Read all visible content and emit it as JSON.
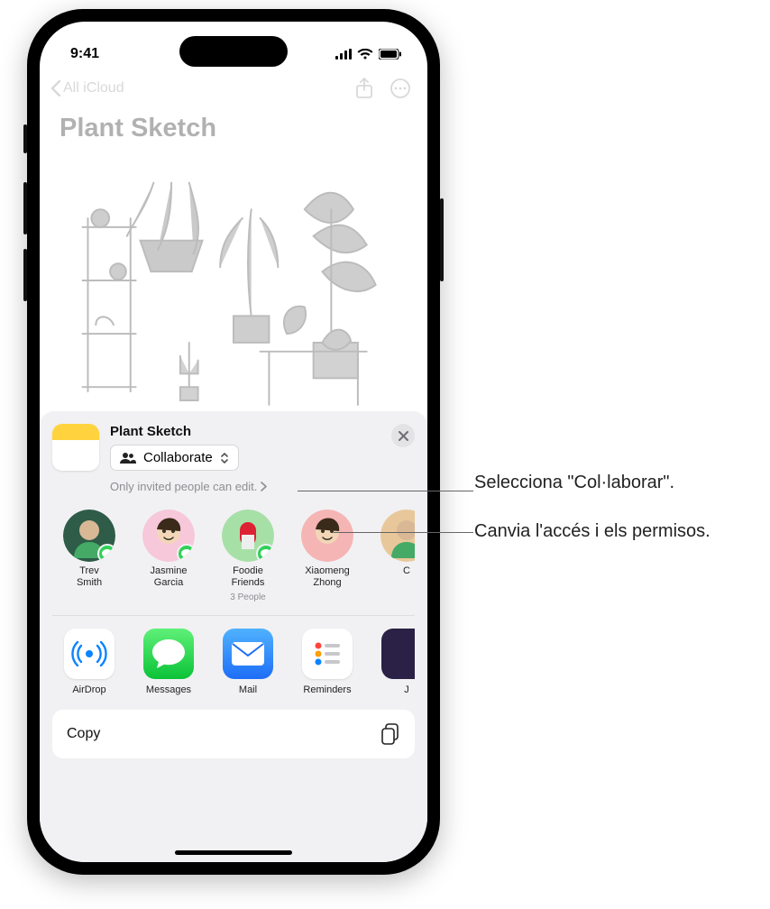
{
  "status": {
    "time": "9:41"
  },
  "nav": {
    "back_label": "All iCloud"
  },
  "note": {
    "title": "Plant Sketch"
  },
  "sheet": {
    "title": "Plant Sketch",
    "collab_label": "Collaborate",
    "permissions_text": "Only invited people can edit."
  },
  "contacts": [
    {
      "name": "Trev Smith",
      "sub": "",
      "avatar_color": "#2e5c48",
      "type": "photo"
    },
    {
      "name": "Jasmine Garcia",
      "sub": "",
      "avatar_color": "#f7c7da",
      "type": "memoji"
    },
    {
      "name": "Foodie Friends",
      "sub": "3 People",
      "avatar_color": "#a7e0a7",
      "type": "group"
    },
    {
      "name": "Xiaomeng Zhong",
      "sub": "",
      "avatar_color": "#f5b5b5",
      "type": "memoji"
    },
    {
      "name": "C",
      "sub": "",
      "avatar_color": "#e8c89a",
      "type": "photo"
    }
  ],
  "apps": [
    {
      "name": "AirDrop",
      "kind": "airdrop"
    },
    {
      "name": "Messages",
      "kind": "messages"
    },
    {
      "name": "Mail",
      "kind": "mail"
    },
    {
      "name": "Reminders",
      "kind": "reminders"
    },
    {
      "name": "J",
      "kind": "partial"
    }
  ],
  "actions": [
    {
      "label": "Copy"
    }
  ],
  "callouts": {
    "c1": "Selecciona \"Col·laborar\".",
    "c2": "Canvia l'accés i els permisos."
  }
}
